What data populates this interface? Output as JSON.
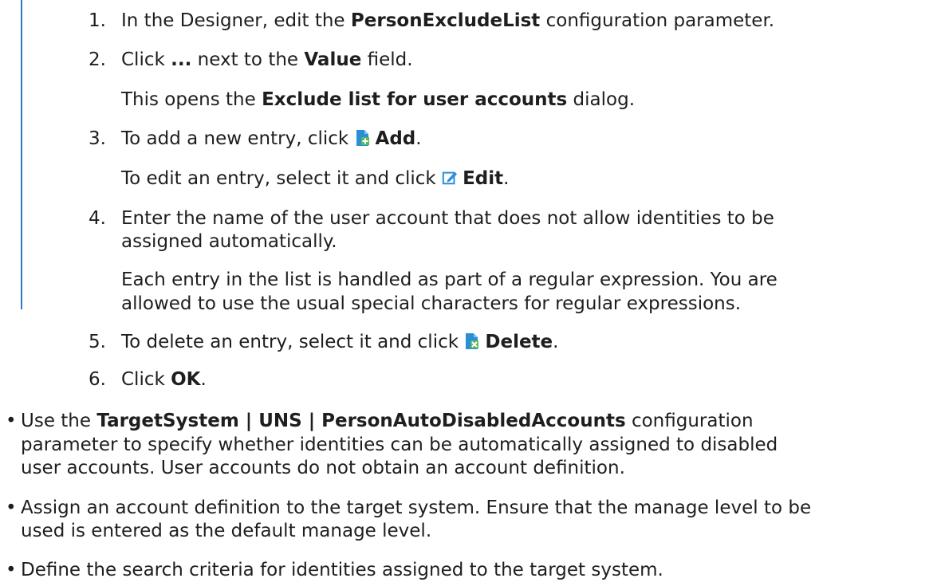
{
  "steps": [
    {
      "num": "1.",
      "pre": "In the Designer, edit the ",
      "b1": "PersonExcludeList",
      "post": " configuration parameter."
    },
    {
      "num": "2.",
      "pre": "Click ",
      "b1": "...",
      "mid": " next to the ",
      "b2": "Value",
      "post": " field."
    },
    {
      "pre": "This opens the ",
      "b1": "Exclude list for user accounts",
      "post": " dialog."
    },
    {
      "num": "3.",
      "pre": "To add a new entry, click ",
      "b1": "Add",
      "post": ".",
      "icon": "add-icon"
    },
    {
      "pre": "To edit an entry, select it and click ",
      "b1": "Edit",
      "post": ".",
      "icon": "edit-icon"
    },
    {
      "num": "4.",
      "line1": "Enter the name of the user account that does not allow identities to be",
      "line2": "assigned automatically."
    },
    {
      "line1": "Each entry in the list is handled as part of a regular expression. You are",
      "line2": "allowed to use the usual special characters for regular expressions."
    },
    {
      "num": "5.",
      "pre": "To delete an entry, select it and click ",
      "b1": "Delete",
      "post": ".",
      "icon": "delete-icon"
    },
    {
      "num": "6.",
      "pre": "Click ",
      "b1": "OK",
      "post": "."
    }
  ],
  "bullets": [
    {
      "mark": "•",
      "pre": "Use the ",
      "b1": "TargetSystem | UNS | PersonAutoDisabledAccounts",
      "line1_post": " configuration",
      "line2": "parameter to specify whether identities can be automatically assigned to disabled",
      "line3": "user accounts. User accounts do not obtain an account definition."
    },
    {
      "mark": "•",
      "line1": "Assign an account definition to the target system. Ensure that the manage level to be",
      "line2": "used is entered as the default manage level."
    },
    {
      "mark": "•",
      "line1": "Define the search criteria for identities assigned to the target system."
    }
  ],
  "colors": {
    "accent": "#2a78c6",
    "add_icon": "#2a8fd8",
    "add_plus": "#5cb85c",
    "edit_icon": "#2a8fd8",
    "delete_x": "#5cb85c"
  }
}
